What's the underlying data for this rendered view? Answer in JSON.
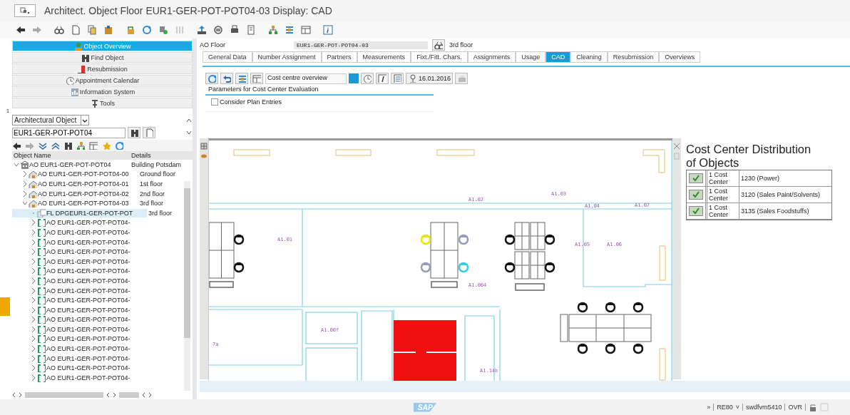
{
  "window": {
    "title": "Architect. Object Floor EUR1-GER-POT-POT04-03 Display: CAD"
  },
  "navigation": [
    {
      "label": "Object Overview",
      "selected": true
    },
    {
      "label": "Find Object",
      "selected": false
    },
    {
      "label": "Resubmission",
      "selected": false
    },
    {
      "label": "Appointment Calendar",
      "selected": false
    },
    {
      "label": "Information System",
      "selected": false
    },
    {
      "label": "Tools",
      "selected": false
    }
  ],
  "locator": {
    "marker": "1",
    "object_type": "Architectural Object",
    "search_value": "EUR1-GER-POT-POT04"
  },
  "tree": {
    "columns": [
      "Object Name",
      "Details"
    ],
    "items": [
      {
        "kind": "building",
        "name": "AO EUR1-GER-POT-POT04",
        "details": "Building Potsdam",
        "expanded": true,
        "selected": false,
        "children": [
          {
            "kind": "floor",
            "name": "AO EUR1-GER-POT-POT04-00",
            "details": "Ground floor",
            "expanded": false,
            "selected": false
          },
          {
            "kind": "floor",
            "name": "AO EUR1-GER-POT-POT04-01",
            "details": "1st floor",
            "expanded": false,
            "selected": false
          },
          {
            "kind": "floor",
            "name": "AO EUR1-GER-POT-POT04-02",
            "details": "2nd floor",
            "expanded": false,
            "selected": false
          },
          {
            "kind": "floor",
            "name": "AO EUR1-GER-POT-POT04-03",
            "details": "3rd floor",
            "expanded": true,
            "selected": false,
            "children": [
              {
                "kind": "plan",
                "name": "FL DPGEUR1-GER-POT-POT",
                "details": "3rd floor",
                "selected": true
              },
              {
                "kind": "room",
                "name": "AO EUR1-GER-POT-POT04-",
                "expanded": false,
                "selected": false
              },
              {
                "kind": "room",
                "name": "AO EUR1-GER-POT-POT04-",
                "expanded": false,
                "selected": false
              },
              {
                "kind": "room",
                "name": "AO EUR1-GER-POT-POT04-",
                "expanded": false,
                "selected": false
              },
              {
                "kind": "room",
                "name": "AO EUR1-GER-POT-POT04-",
                "expanded": false,
                "selected": false
              },
              {
                "kind": "room",
                "name": "AO EUR1-GER-POT-POT04-",
                "expanded": false,
                "selected": false
              },
              {
                "kind": "room",
                "name": "AO EUR1-GER-POT-POT04-",
                "expanded": false,
                "selected": false
              },
              {
                "kind": "room",
                "name": "AO EUR1-GER-POT-POT04-",
                "expanded": false,
                "selected": false
              },
              {
                "kind": "room",
                "name": "AO EUR1-GER-POT-POT04-",
                "expanded": false,
                "selected": false
              },
              {
                "kind": "room",
                "name": "AO EUR1-GER-POT-POT04-",
                "expanded": false,
                "selected": false
              },
              {
                "kind": "room",
                "name": "AO EUR1-GER-POT-POT04-",
                "expanded": false,
                "selected": false
              },
              {
                "kind": "room",
                "name": "AO EUR1-GER-POT-POT04-",
                "expanded": false,
                "selected": false
              },
              {
                "kind": "room",
                "name": "AO EUR1-GER-POT-POT04-",
                "expanded": false,
                "selected": false
              },
              {
                "kind": "room",
                "name": "AO EUR1-GER-POT-POT04-",
                "expanded": false,
                "selected": false
              },
              {
                "kind": "room",
                "name": "AO EUR1-GER-POT-POT04-",
                "expanded": false,
                "selected": false
              },
              {
                "kind": "room",
                "name": "AO EUR1-GER-POT-POT04-",
                "expanded": false,
                "selected": false
              },
              {
                "kind": "room",
                "name": "AO EUR1-GER-POT-POT04-",
                "expanded": false,
                "selected": false
              },
              {
                "kind": "room",
                "name": "AO EUR1-GER-POT-POT04-",
                "expanded": false,
                "selected": false
              }
            ]
          }
        ]
      }
    ]
  },
  "header": {
    "label": "AO Floor",
    "object": "EUR1-GER-POT-POT04-03",
    "description": "3rd floor"
  },
  "tabs": [
    {
      "label": "General Data",
      "selected": false
    },
    {
      "label": "Number Assignment",
      "selected": false
    },
    {
      "label": "Partners",
      "selected": false
    },
    {
      "label": "Measurements",
      "selected": false
    },
    {
      "label": "Fixt./Fitt. Chars.",
      "selected": false
    },
    {
      "label": "Assignments",
      "selected": false
    },
    {
      "label": "Usage",
      "selected": false
    },
    {
      "label": "CAD",
      "selected": true
    },
    {
      "label": "Cleaning",
      "selected": false
    },
    {
      "label": "Resubmission",
      "selected": false
    },
    {
      "label": "Overviews",
      "selected": false
    }
  ],
  "cad_toolbar": {
    "view": "Cost centre overview",
    "date": "16.01.2016"
  },
  "parameters": {
    "title": "Parameters for Cost Center Evaluation",
    "options": [
      {
        "label": "Consider Plan Entries",
        "checked": false
      }
    ]
  },
  "floor_plan": {
    "room_labels": [
      "A1.01",
      "A1.02",
      "A1.03",
      "A1.04",
      "A1.07",
      "A1.05",
      "A1.06",
      "A1.004",
      "A1.00f",
      "A1.14b",
      "7a"
    ]
  },
  "cost_centers": {
    "title": "Cost Center Distribution of Objects",
    "rows": [
      {
        "checked": true,
        "count": "1 Cost Center",
        "center": "1230 (Power)"
      },
      {
        "checked": true,
        "count": "1 Cost Center",
        "center": "3120 (Sales Paint/Solvents)"
      },
      {
        "checked": true,
        "count": "1 Cost Center",
        "center": "3135 (Sales Foodstuffs)"
      }
    ]
  },
  "status_bar": {
    "logo": "SAP",
    "expand": "»",
    "transaction": "RE80",
    "dropdown": "˅",
    "server": "swdfvm5410",
    "mode": "OVR"
  }
}
